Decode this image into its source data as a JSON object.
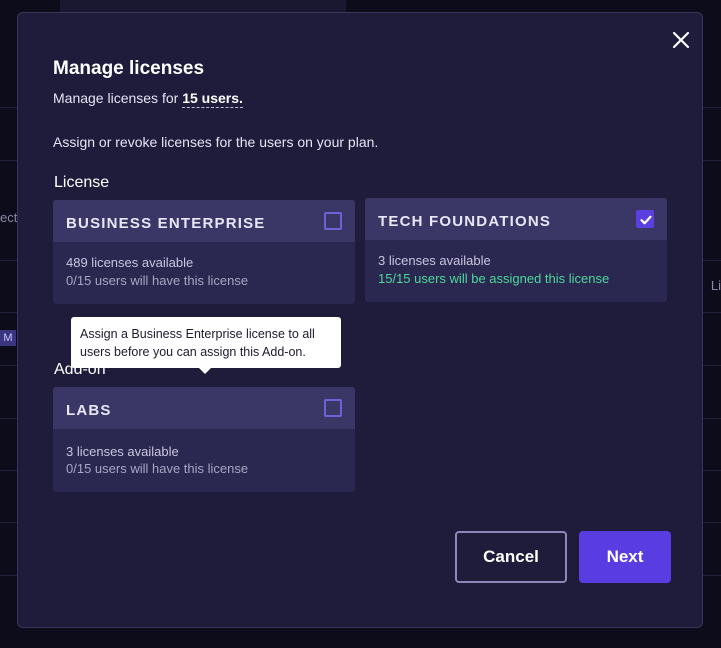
{
  "background": {
    "left_text": "ect",
    "left_badge": "M",
    "right_text": "Li"
  },
  "modal": {
    "title": "Manage licenses",
    "subtitle_prefix": "Manage licenses for ",
    "subtitle_users": "15 users.",
    "description": "Assign or revoke licenses for the users on your plan.",
    "license_section_label": "License",
    "addon_section_label": "Add-on",
    "close_icon": "close-icon"
  },
  "licenses": [
    {
      "name": "BUSINESS ENTERPRISE",
      "available": "489 licenses available",
      "status": "0/15 users will have this license",
      "checked": false
    },
    {
      "name": "TECH FOUNDATIONS",
      "available": "3 licenses available",
      "status": "15/15 users will be assigned this license",
      "checked": true
    }
  ],
  "addons": [
    {
      "name": "LABS",
      "available": "3 licenses available",
      "status": "0/15 users will have this license",
      "checked": false
    }
  ],
  "tooltip": {
    "text": "Assign a Business Enterprise license to all users before you can assign this Add-on."
  },
  "footer": {
    "cancel_label": "Cancel",
    "next_label": "Next"
  },
  "colors": {
    "accent": "#5a3de2",
    "success": "#4fd89a",
    "modal_bg": "#1e1c3a",
    "card_bg": "#2a2750",
    "card_header_bg": "#3a3766"
  }
}
